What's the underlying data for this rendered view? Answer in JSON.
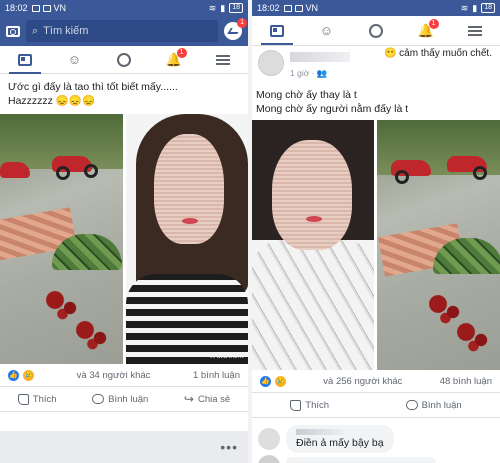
{
  "left": {
    "status": {
      "time": "18:02",
      "carrier": "VN",
      "battery": "18"
    },
    "search": {
      "placeholder": "Tìm kiếm",
      "messenger_badge": "1"
    },
    "nav": {
      "notifications_badge": "1"
    },
    "post": {
      "text_line1": "Ước gì đấy là tao thì tốt biết mấy......",
      "text_line2": "Hazzzzzz 😞😞😞",
      "photo_watermark": "WutaCam",
      "reactions_count": "và 34 người khác",
      "comments_count": "1 bình luận",
      "actions": {
        "like": "Thích",
        "comment": "Bình luận",
        "share": "Chia sẻ"
      }
    },
    "more": "•••"
  },
  "right": {
    "status": {
      "time": "18:02",
      "carrier": "VN",
      "battery": "18"
    },
    "nav": {
      "notifications_badge": "1"
    },
    "post": {
      "tagline": "😶 cảm thấy muốn chết.",
      "time": "1 giờ · 👥",
      "text_line1": "Mong chờ ấy thay là t",
      "text_line2": "Mong chờ ấy người nằm đấy là t",
      "reactions_count": "và 256 người khác",
      "comments_count": "48 bình luận",
      "actions": {
        "like": "Thích",
        "comment": "Bình luận"
      }
    },
    "comment": {
      "text": "Điền ả mấy bậy bạ"
    }
  }
}
